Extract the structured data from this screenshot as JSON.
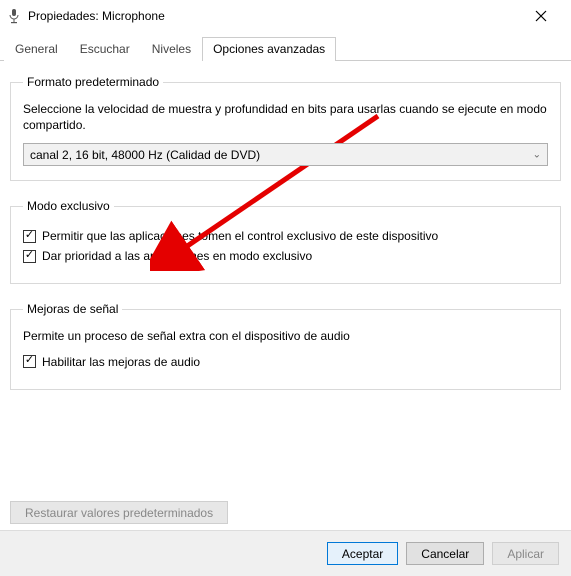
{
  "titlebar": {
    "title": "Propiedades: Microphone"
  },
  "tabs": {
    "general": "General",
    "escuchar": "Escuchar",
    "niveles": "Niveles",
    "avanzadas": "Opciones avanzadas"
  },
  "formato": {
    "legend": "Formato predeterminado",
    "desc": "Seleccione la velocidad de muestra y profundidad en bits para usarlas cuando se ejecute en modo compartido.",
    "selected": "canal 2, 16 bit, 48000 Hz (Calidad de DVD)"
  },
  "exclusivo": {
    "legend": "Modo exclusivo",
    "opt1": "Permitir que las aplicaciones tomen el control exclusivo de este dispositivo",
    "opt2": "Dar prioridad a las aplicaciones en modo exclusivo"
  },
  "mejoras": {
    "legend": "Mejoras de señal",
    "desc": "Permite un proceso de señal extra con el dispositivo de audio",
    "opt1": "Habilitar las mejoras de audio"
  },
  "buttons": {
    "restore": "Restaurar valores predeterminados",
    "ok": "Aceptar",
    "cancel": "Cancelar",
    "apply": "Aplicar"
  }
}
